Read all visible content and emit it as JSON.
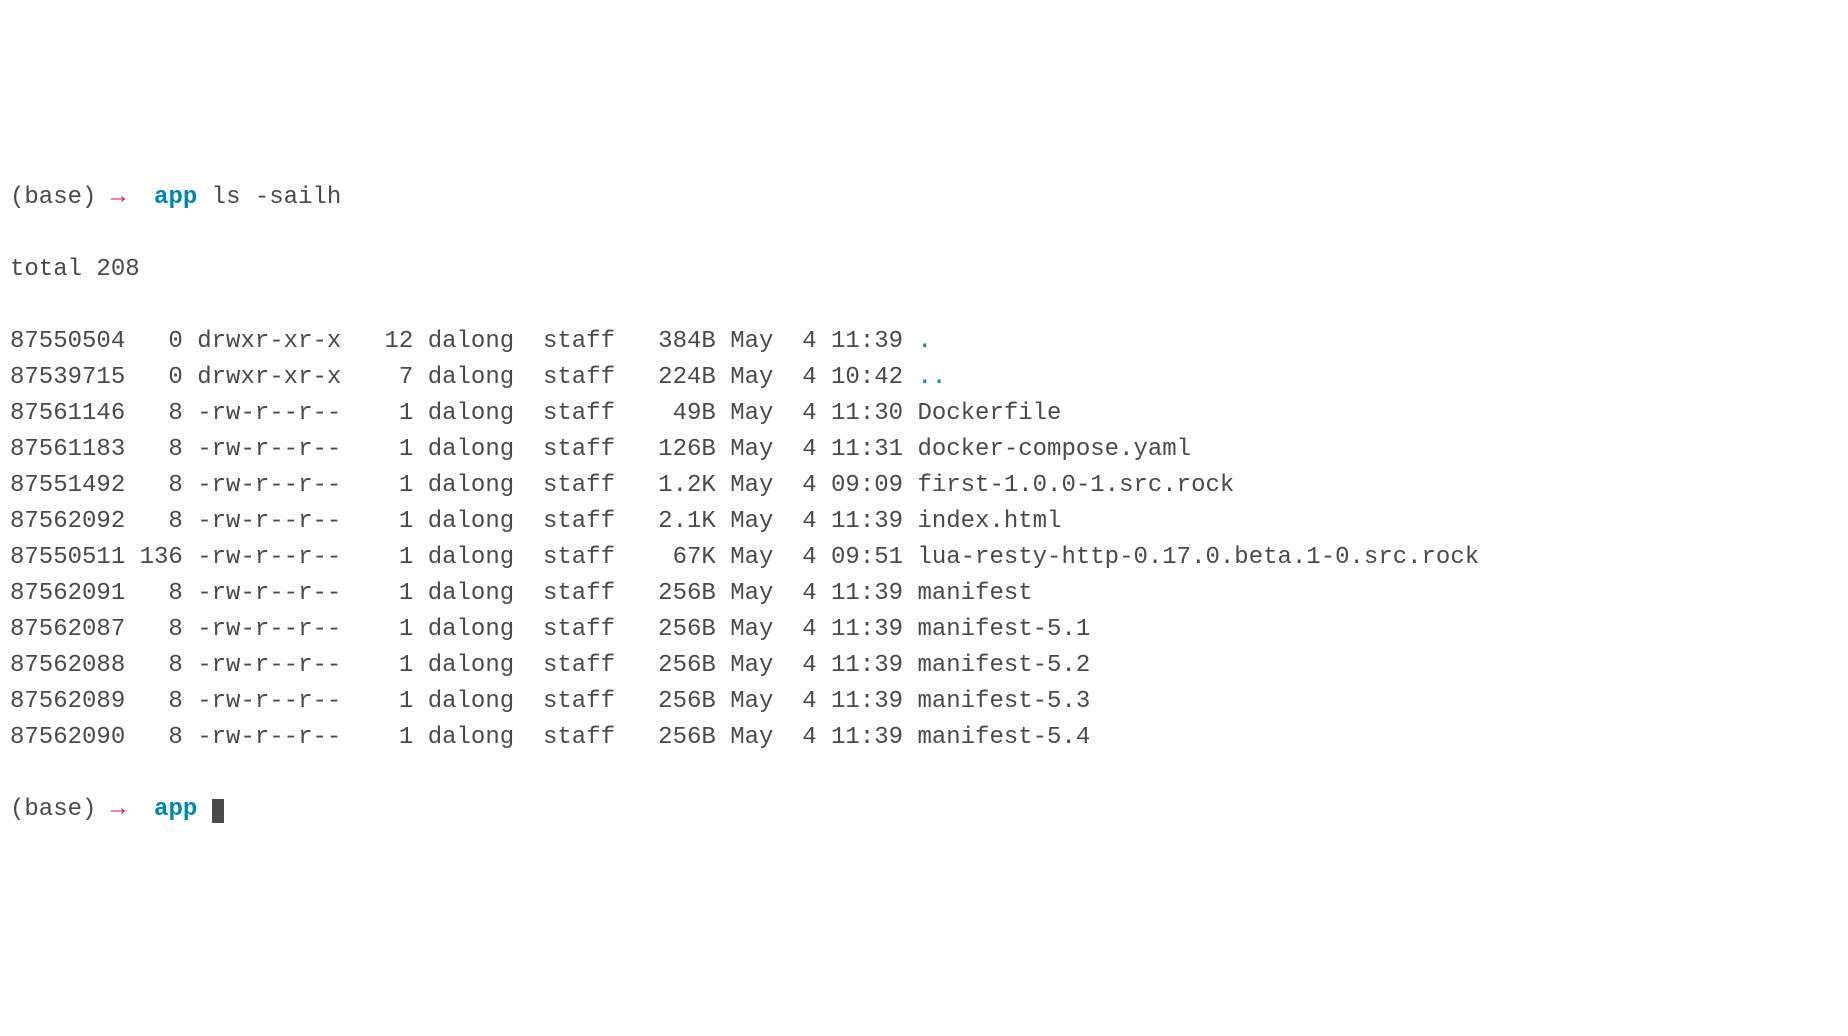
{
  "prompt": {
    "base": "(base)",
    "arrow": "→",
    "dir": "app",
    "command": "ls -sailh"
  },
  "total_line": "total 208",
  "rows": [
    {
      "inode": "87550504",
      "blocks": "  0",
      "perms": "drwxr-xr-x",
      "links": " 12",
      "user": "dalong",
      "group": "staff",
      "size": " 384B",
      "date": "May  4 11:39",
      "name": ".",
      "isdir": true
    },
    {
      "inode": "87539715",
      "blocks": "  0",
      "perms": "drwxr-xr-x",
      "links": "  7",
      "user": "dalong",
      "group": "staff",
      "size": " 224B",
      "date": "May  4 10:42",
      "name": "..",
      "isdir": true
    },
    {
      "inode": "87561146",
      "blocks": "  8",
      "perms": "-rw-r--r--",
      "links": "  1",
      "user": "dalong",
      "group": "staff",
      "size": "  49B",
      "date": "May  4 11:30",
      "name": "Dockerfile",
      "isdir": false
    },
    {
      "inode": "87561183",
      "blocks": "  8",
      "perms": "-rw-r--r--",
      "links": "  1",
      "user": "dalong",
      "group": "staff",
      "size": " 126B",
      "date": "May  4 11:31",
      "name": "docker-compose.yaml",
      "isdir": false
    },
    {
      "inode": "87551492",
      "blocks": "  8",
      "perms": "-rw-r--r--",
      "links": "  1",
      "user": "dalong",
      "group": "staff",
      "size": " 1.2K",
      "date": "May  4 09:09",
      "name": "first-1.0.0-1.src.rock",
      "isdir": false
    },
    {
      "inode": "87562092",
      "blocks": "  8",
      "perms": "-rw-r--r--",
      "links": "  1",
      "user": "dalong",
      "group": "staff",
      "size": " 2.1K",
      "date": "May  4 11:39",
      "name": "index.html",
      "isdir": false
    },
    {
      "inode": "87550511",
      "blocks": "136",
      "perms": "-rw-r--r--",
      "links": "  1",
      "user": "dalong",
      "group": "staff",
      "size": "  67K",
      "date": "May  4 09:51",
      "name": "lua-resty-http-0.17.0.beta.1-0.src.rock",
      "isdir": false
    },
    {
      "inode": "87562091",
      "blocks": "  8",
      "perms": "-rw-r--r--",
      "links": "  1",
      "user": "dalong",
      "group": "staff",
      "size": " 256B",
      "date": "May  4 11:39",
      "name": "manifest",
      "isdir": false
    },
    {
      "inode": "87562087",
      "blocks": "  8",
      "perms": "-rw-r--r--",
      "links": "  1",
      "user": "dalong",
      "group": "staff",
      "size": " 256B",
      "date": "May  4 11:39",
      "name": "manifest-5.1",
      "isdir": false
    },
    {
      "inode": "87562088",
      "blocks": "  8",
      "perms": "-rw-r--r--",
      "links": "  1",
      "user": "dalong",
      "group": "staff",
      "size": " 256B",
      "date": "May  4 11:39",
      "name": "manifest-5.2",
      "isdir": false
    },
    {
      "inode": "87562089",
      "blocks": "  8",
      "perms": "-rw-r--r--",
      "links": "  1",
      "user": "dalong",
      "group": "staff",
      "size": " 256B",
      "date": "May  4 11:39",
      "name": "manifest-5.3",
      "isdir": false
    },
    {
      "inode": "87562090",
      "blocks": "  8",
      "perms": "-rw-r--r--",
      "links": "  1",
      "user": "dalong",
      "group": "staff",
      "size": " 256B",
      "date": "May  4 11:39",
      "name": "manifest-5.4",
      "isdir": false
    }
  ],
  "prompt2": {
    "base": "(base)",
    "arrow": "→",
    "dir": "app"
  }
}
